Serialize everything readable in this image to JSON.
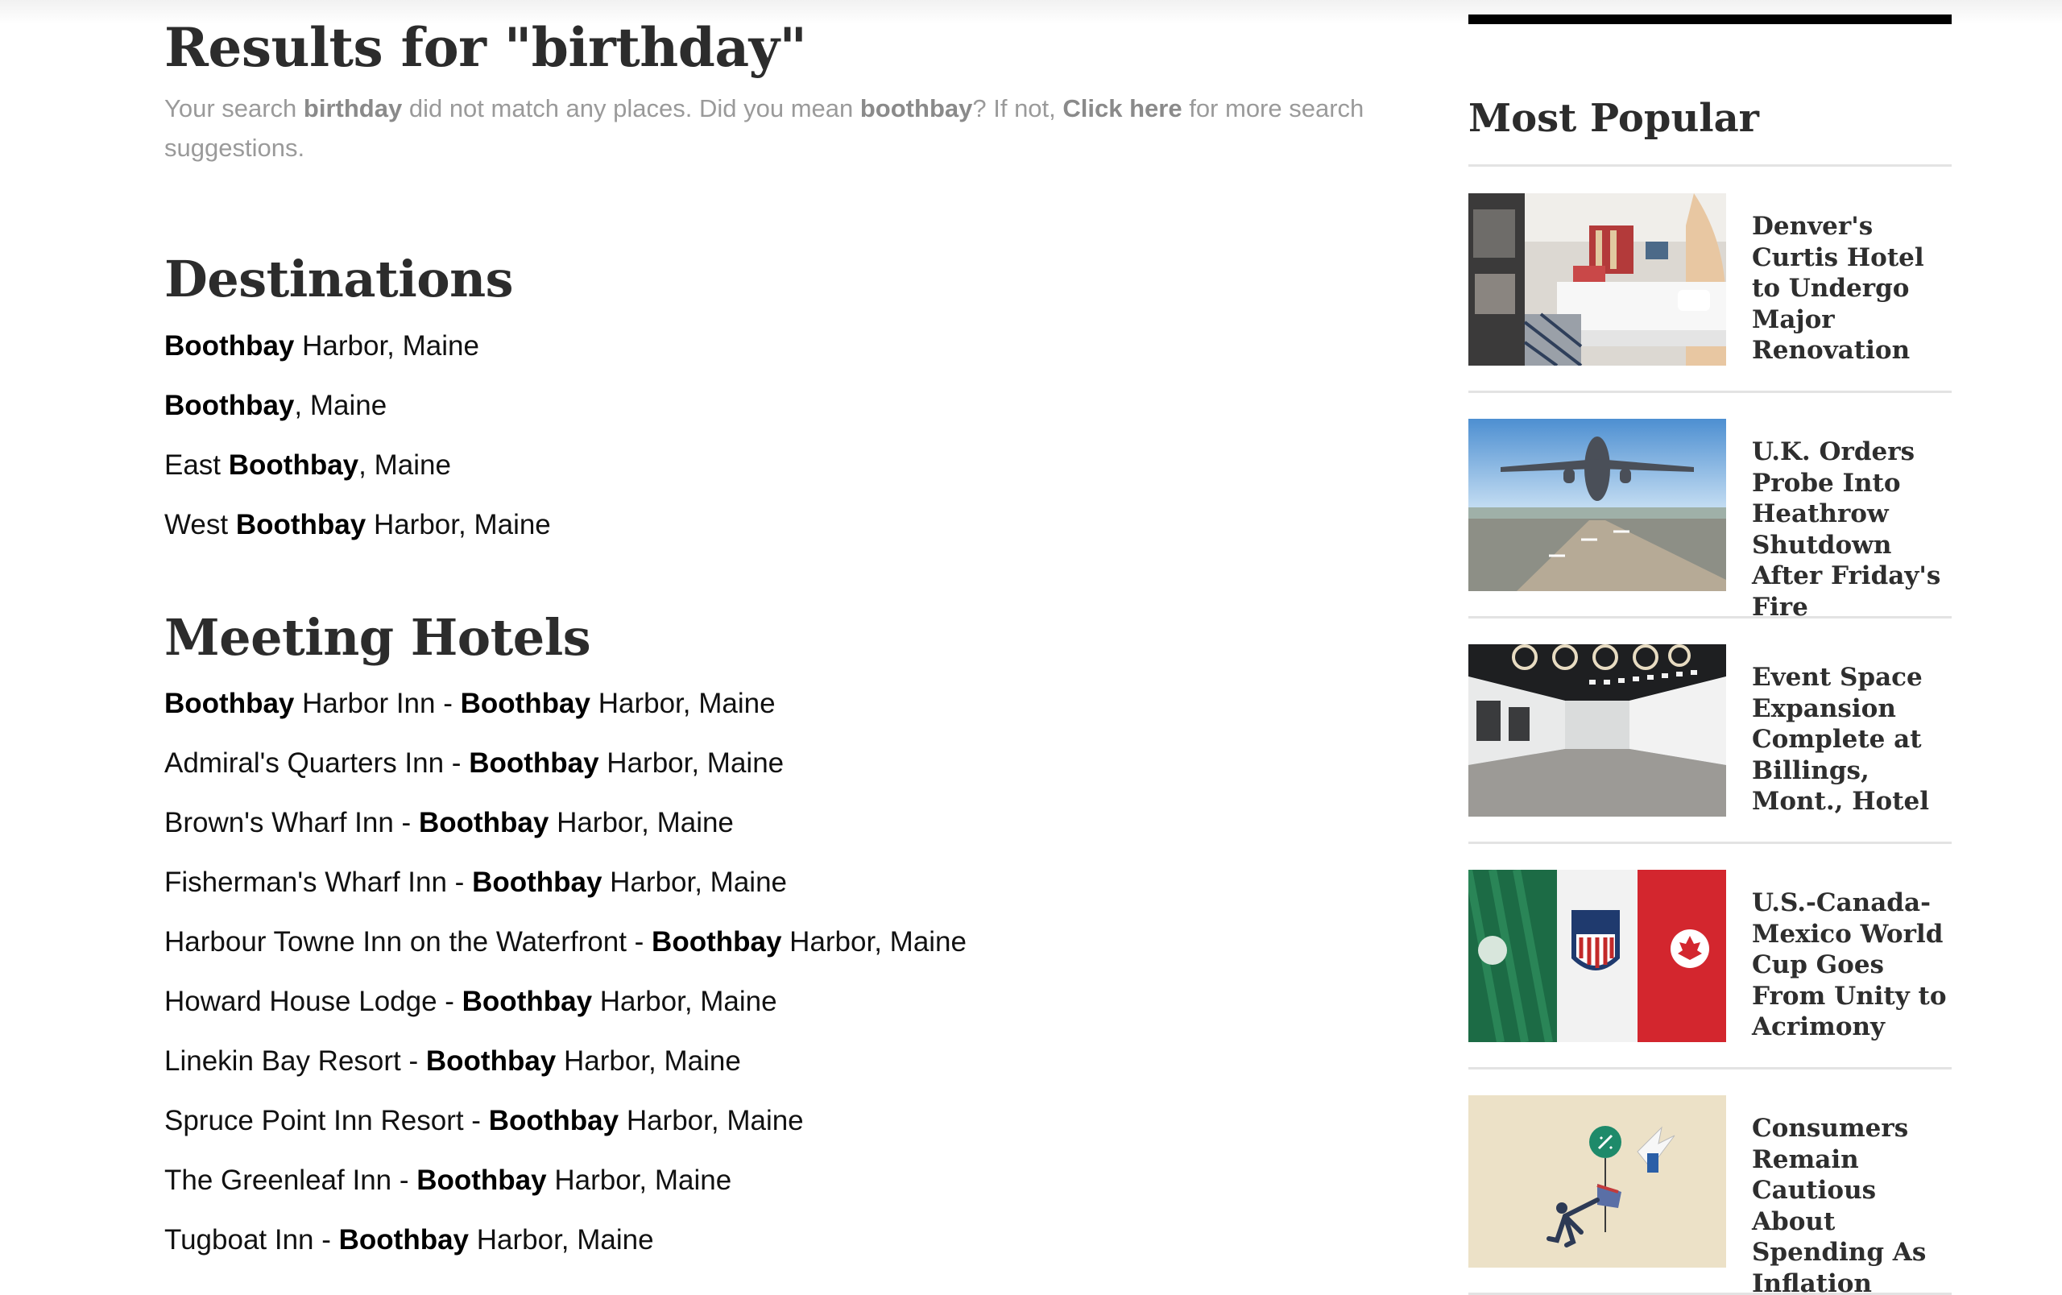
{
  "search": {
    "title": "Results for \"birthday\"",
    "msg_prefix": "Your search ",
    "query": "birthday",
    "msg_middle": " did not match any places. Did you mean ",
    "suggestion": "boothbay",
    "msg_after": "? If not, ",
    "click_here": "Click here",
    "msg_end": " for more search suggestions."
  },
  "destinations": {
    "heading": "Destinations",
    "items": [
      {
        "pre": "",
        "bold": "Boothbay",
        "post": " Harbor, Maine"
      },
      {
        "pre": "",
        "bold": "Boothbay",
        "post": ", Maine"
      },
      {
        "pre": "East ",
        "bold": "Boothbay",
        "post": ", Maine"
      },
      {
        "pre": "West ",
        "bold": "Boothbay",
        "post": " Harbor, Maine"
      }
    ]
  },
  "hotels": {
    "heading": "Meeting Hotels",
    "items": [
      {
        "pre": "",
        "bold1": "Boothbay",
        "mid": " Harbor Inn - ",
        "bold2": "Boothbay",
        "post": " Harbor, Maine"
      },
      {
        "pre": "",
        "bold1": "",
        "mid": "Admiral's Quarters Inn - ",
        "bold2": "Boothbay",
        "post": " Harbor, Maine"
      },
      {
        "pre": "",
        "bold1": "",
        "mid": "Brown's Wharf Inn - ",
        "bold2": "Boothbay",
        "post": " Harbor, Maine"
      },
      {
        "pre": "",
        "bold1": "",
        "mid": "Fisherman's Wharf Inn - ",
        "bold2": "Boothbay",
        "post": " Harbor, Maine"
      },
      {
        "pre": "",
        "bold1": "",
        "mid": "Harbour Towne Inn on the Waterfront - ",
        "bold2": "Boothbay",
        "post": " Harbor, Maine"
      },
      {
        "pre": "",
        "bold1": "",
        "mid": "Howard House Lodge - ",
        "bold2": "Boothbay",
        "post": " Harbor, Maine"
      },
      {
        "pre": "",
        "bold1": "",
        "mid": "Linekin Bay Resort - ",
        "bold2": "Boothbay",
        "post": " Harbor, Maine"
      },
      {
        "pre": "",
        "bold1": "",
        "mid": "Spruce Point Inn Resort - ",
        "bold2": "Boothbay",
        "post": " Harbor, Maine"
      },
      {
        "pre": "",
        "bold1": "",
        "mid": "The Greenleaf Inn - ",
        "bold2": "Boothbay",
        "post": " Harbor, Maine"
      },
      {
        "pre": "",
        "bold1": "",
        "mid": "Tugboat Inn - ",
        "bold2": "Boothbay",
        "post": " Harbor, Maine"
      }
    ]
  },
  "sidebar": {
    "heading": "Most Popular",
    "articles": [
      {
        "headline": "Denver's Curtis Hotel to Undergo Major Renovation",
        "image": "hotel-room-image"
      },
      {
        "headline": "U.K. Orders Probe Into Heathrow Shutdown After Friday's Fire",
        "image": "airplane-takeoff-image"
      },
      {
        "headline": "Event Space Expansion Complete at Billings, Mont., Hotel",
        "image": "event-hall-image"
      },
      {
        "headline": "U.S.-Canada-Mexico World Cup Goes From Unity to Acrimony",
        "image": "soccer-jerseys-image"
      },
      {
        "headline": "Consumers Remain Cautious About Spending As Inflation Rises",
        "image": "inflation-illustration-image"
      }
    ]
  },
  "colors": {
    "heading": "#2c2c2c",
    "muted_text": "#9a9a9a",
    "body_text": "#111111",
    "rule": "#e3e3e3"
  }
}
